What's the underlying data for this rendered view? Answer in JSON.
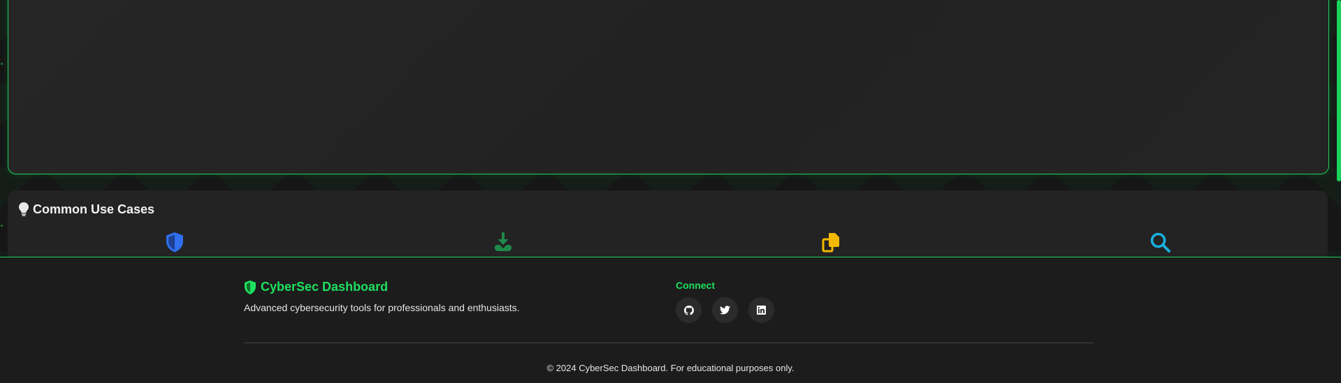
{
  "use_cases": {
    "title": "Common Use Cases",
    "title_icon": "lightbulb-icon",
    "items": [
      {
        "icon": "shield-icon",
        "color": "#2f6ff0"
      },
      {
        "icon": "download-icon",
        "color": "#1e8a4a"
      },
      {
        "icon": "copy-icon",
        "color": "#f5b800"
      },
      {
        "icon": "search-icon",
        "color": "#1ab0e0"
      }
    ]
  },
  "footer": {
    "brand": "CyberSec Dashboard",
    "brand_icon": "shield-icon",
    "tagline": "Advanced cybersecurity tools for professionals and enthusiasts.",
    "connect_heading": "Connect",
    "socials": [
      {
        "icon": "github-icon"
      },
      {
        "icon": "twitter-icon"
      },
      {
        "icon": "linkedin-icon"
      }
    ],
    "copyright": "© 2024 CyberSec Dashboard. For educational purposes only."
  },
  "colors": {
    "accent": "#1ee05e",
    "panel_border": "#1fd15b"
  }
}
